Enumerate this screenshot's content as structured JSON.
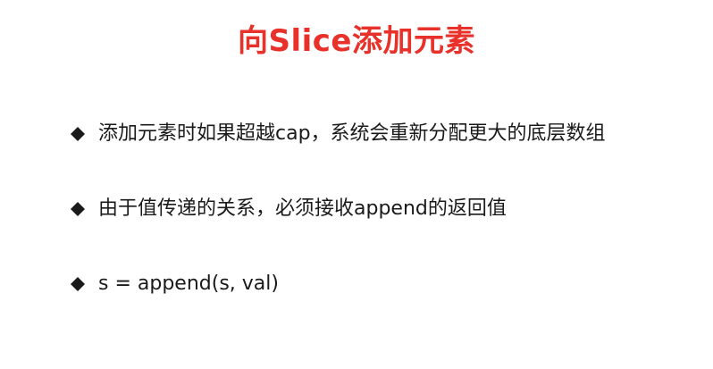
{
  "slide": {
    "title": "向Slice添加元素",
    "title_color": "#e8312a",
    "bullet_icon": "diamond-icon",
    "bullets": [
      {
        "text": "添加元素时如果超越cap，系统会重新分配更大的底层数组"
      },
      {
        "text": "由于值传递的关系，必须接收append的返回值"
      },
      {
        "text": "s = append(s, val)"
      }
    ]
  }
}
